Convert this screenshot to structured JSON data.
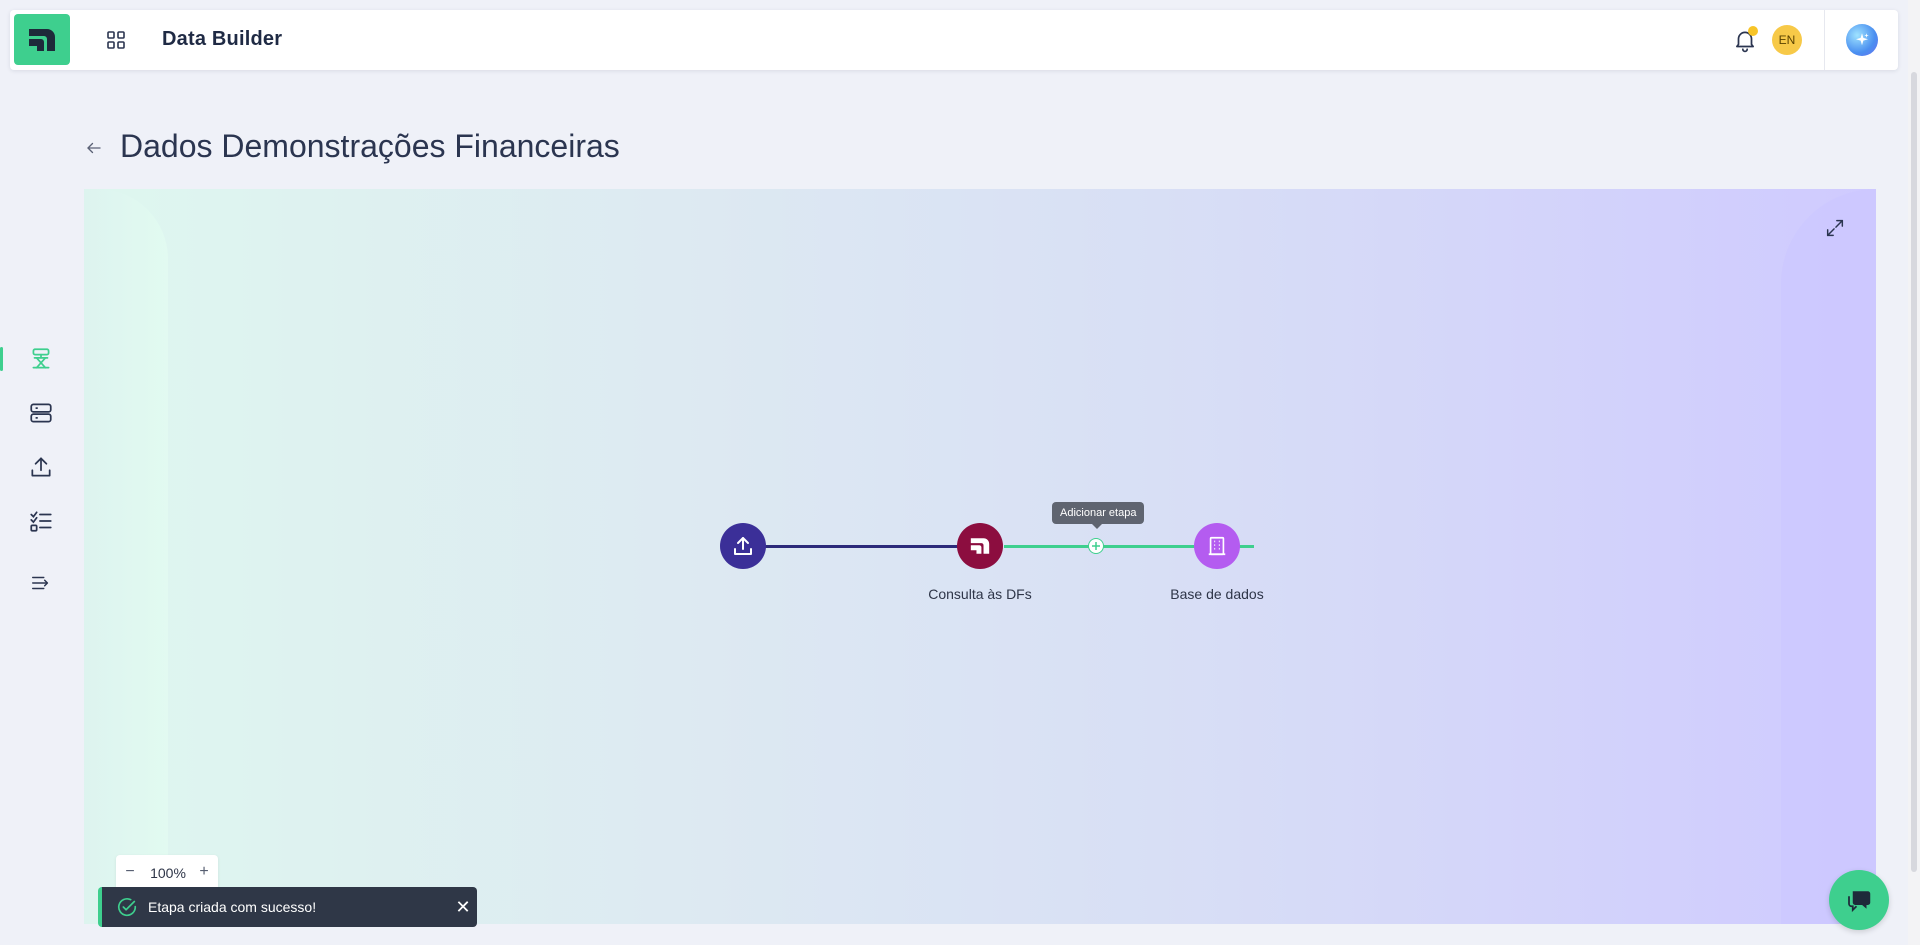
{
  "header": {
    "app_title": "Data Builder",
    "language": "EN",
    "icons": [
      "app-logo-icon",
      "apps-grid-icon",
      "bell-icon",
      "ai-sparkle-icon"
    ],
    "notification_dot_color": "#f7c427"
  },
  "sidebar": {
    "items": [
      {
        "icon": "pipeline-icon",
        "active": true
      },
      {
        "icon": "database-icon",
        "active": false
      },
      {
        "icon": "upload-icon",
        "active": false
      },
      {
        "icon": "checklist-icon",
        "active": false
      },
      {
        "icon": "collapse-menu-icon",
        "active": false
      }
    ],
    "accent": "#3ecf8e"
  },
  "page": {
    "title": "Dados Demonstrações Financeiras"
  },
  "flow": {
    "nodes": [
      {
        "id": "upload",
        "label": "",
        "icon": "upload-icon",
        "color": "#3b2f98"
      },
      {
        "id": "consulta",
        "label": "Consulta às DFs",
        "icon": "app-logo-icon",
        "color": "#8c0d3f"
      },
      {
        "id": "base",
        "label": "Base de dados",
        "icon": "building-icon",
        "color": "#b45cf0"
      }
    ],
    "edge_colors": [
      "#2c2a7a",
      "#3ecf8e"
    ],
    "add_step_tooltip": "Adicionar etapa"
  },
  "zoom": {
    "value": "100%",
    "minus": "−",
    "plus": "+"
  },
  "toast": {
    "message": "Etapa criada com sucesso!",
    "close": "✕",
    "color": "#2f3747"
  },
  "chat": {
    "icon": "chat-icon",
    "color": "#3ecf8e"
  }
}
